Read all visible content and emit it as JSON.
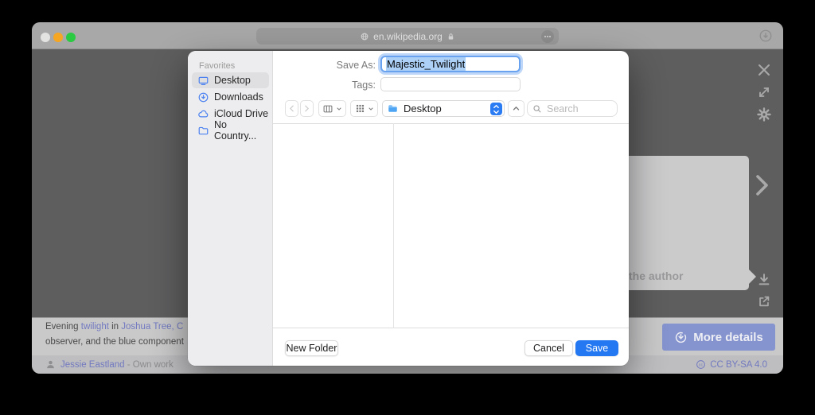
{
  "browser": {
    "url_text": "en.wikipedia.org"
  },
  "viewer": {
    "caption": {
      "part1": "Evening ",
      "link1": "twilight",
      "part2": " in ",
      "link2": "Joshua Tree, C",
      "line2": "observer, and the blue component"
    },
    "panel_text": "the author",
    "author_link": "Jessie Eastland",
    "author_rest": " - Own work",
    "license_label": "CC BY-SA 4.0",
    "more_details_label": "More details"
  },
  "dialog": {
    "save_as_label": "Save As:",
    "filename_value": "Majestic_Twilight",
    "tags_label": "Tags:",
    "favorites_header": "Favorites",
    "sidebar_items": [
      {
        "label": "Desktop"
      },
      {
        "label": "Downloads"
      },
      {
        "label": "iCloud Drive"
      },
      {
        "label": "No Country..."
      }
    ],
    "location_value": "Desktop",
    "search_placeholder": "Search",
    "new_folder_label": "New Folder",
    "cancel_label": "Cancel",
    "save_label": "Save"
  },
  "colors": {
    "accent_blue": "#2B7BF3",
    "save_button_blue": "#2478F2",
    "dimmed_link_blue": "#7179C0",
    "viewer_background": "#5E5E5F"
  }
}
